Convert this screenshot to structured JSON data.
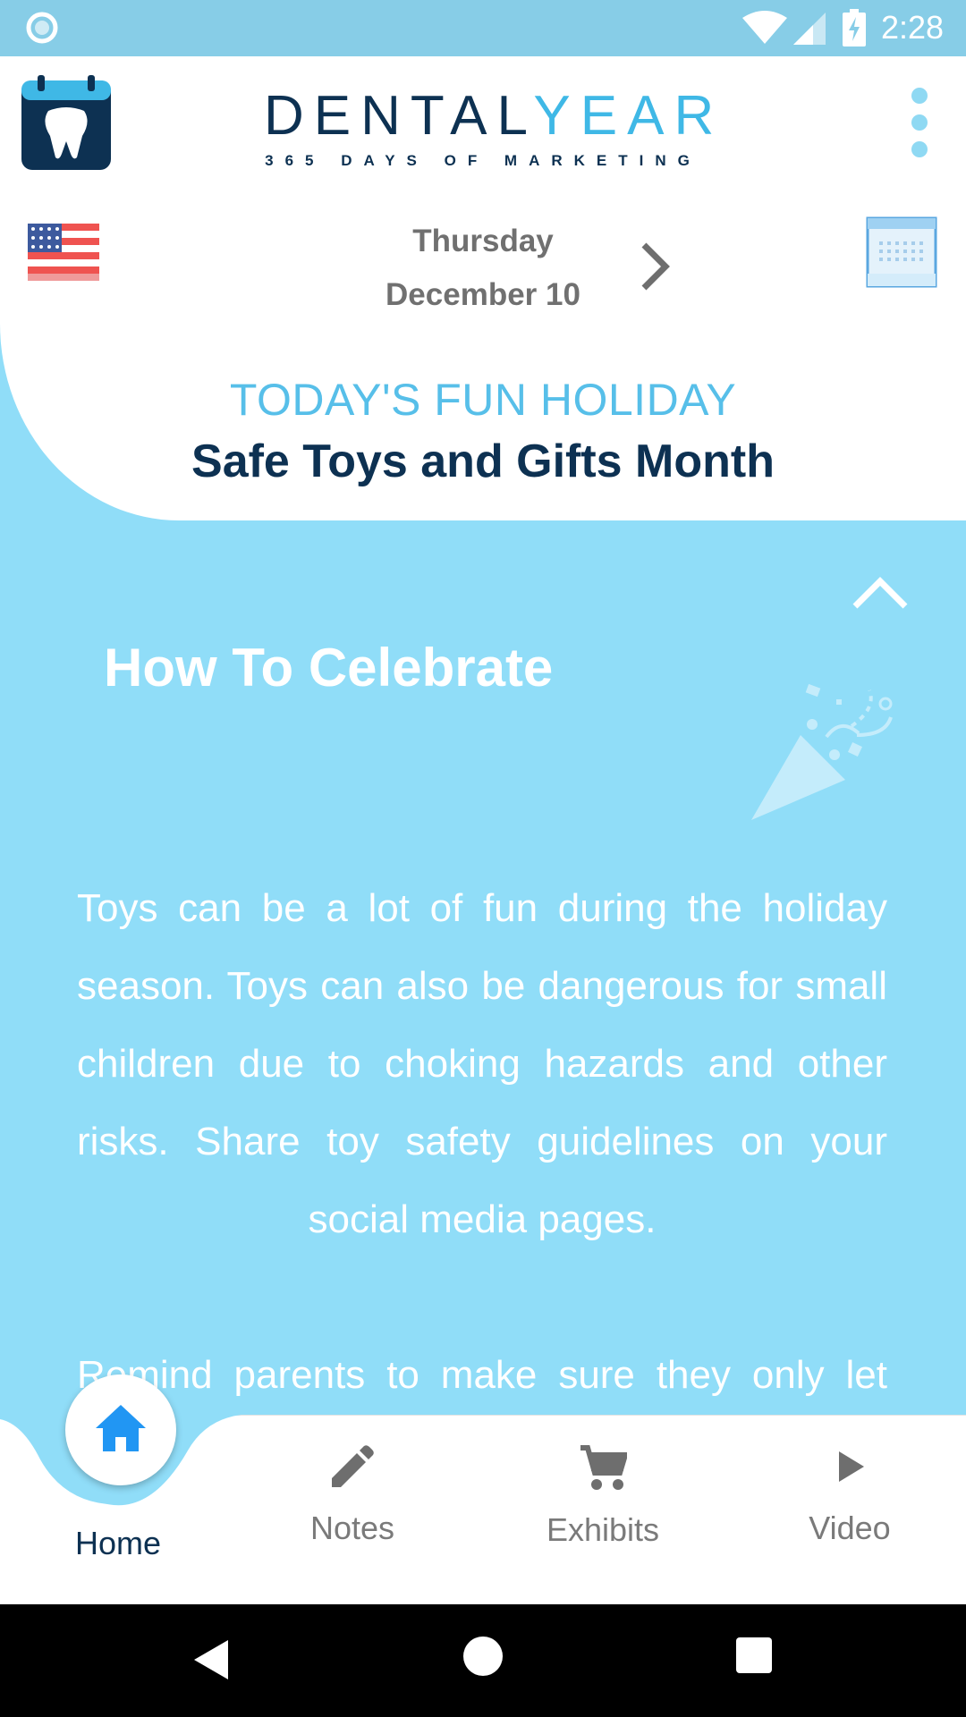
{
  "status_bar": {
    "time": "2:28"
  },
  "header": {
    "logo_main_dental": "DENTAL",
    "logo_main_year": "YEAR",
    "logo_sub": "365 DAYS OF MARKETING"
  },
  "date_nav": {
    "day": "Thursday",
    "date": "December 10"
  },
  "holiday": {
    "kicker": "TODAY'S FUN HOLIDAY",
    "title": "Safe Toys and Gifts Month"
  },
  "section": {
    "title": "How To Celebrate",
    "paragraph1": "Toys can be a lot of fun during the holiday season. Toys can also be dangerous for small children due to choking hazards and other risks. Share toy safety guidelines on your social media pages.",
    "paragraph2": "Remind parents to make sure they only let their children play with toys that are"
  },
  "bottom_nav": {
    "items": [
      {
        "label": "Home",
        "icon": "home-icon",
        "active": true
      },
      {
        "label": "Notes",
        "icon": "pencil-icon"
      },
      {
        "label": "Exhibits",
        "icon": "cart-icon"
      },
      {
        "label": "Video",
        "icon": "play-icon"
      }
    ]
  },
  "colors": {
    "status_bar": "#87CDE7",
    "content_bg": "#90DDF8",
    "navy": "#0d3152",
    "accent_blue": "#3fb8e6",
    "home_active": "#2196F3"
  }
}
